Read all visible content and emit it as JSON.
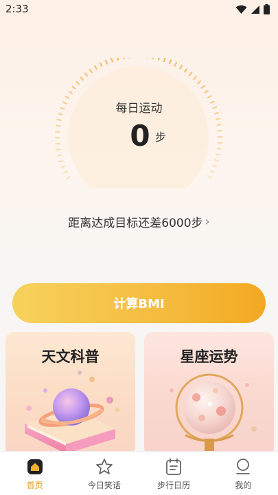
{
  "status_bar": {
    "time": "2:33",
    "icons": [
      "wifi-icon",
      "signal-icon",
      "battery-icon"
    ]
  },
  "step_dial": {
    "title": "每日运动",
    "steps": "0",
    "unit": "步"
  },
  "goal": {
    "text": "距离达成目标还差6000步",
    "chevron": "›"
  },
  "bmi_button": {
    "label": "计算BMI"
  },
  "cards": [
    {
      "title": "天文科普",
      "icon": "astronomy-book-planet-illustration"
    },
    {
      "title": "星座运势",
      "icon": "globe-illustration"
    }
  ],
  "tabs": [
    {
      "label": "首页",
      "icon": "home-icon",
      "active": true
    },
    {
      "label": "今日笑话",
      "icon": "star-icon",
      "active": false
    },
    {
      "label": "步行日历",
      "icon": "calendar-icon",
      "active": false
    },
    {
      "label": "我的",
      "icon": "profile-icon",
      "active": false
    }
  ],
  "colors": {
    "accent": "#f5b02e",
    "active_tab": "#e79a1d",
    "dial_ring": "#f6b34e"
  }
}
